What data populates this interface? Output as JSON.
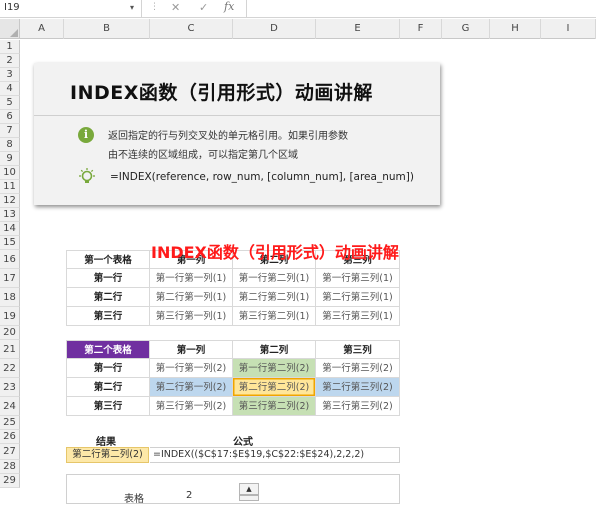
{
  "formula_bar": {
    "name_box": "I19",
    "cancel_icon": "✕",
    "confirm_icon": "✓",
    "fx_label": "fx"
  },
  "columns": [
    "A",
    "B",
    "C",
    "D",
    "E",
    "F",
    "G",
    "H",
    "I"
  ],
  "rows": [
    "1",
    "2",
    "3",
    "4",
    "5",
    "6",
    "7",
    "8",
    "9",
    "10",
    "11",
    "12",
    "13",
    "14",
    "15",
    "16",
    "17",
    "18",
    "19",
    "20",
    "21",
    "22",
    "23",
    "24",
    "25",
    "26",
    "27",
    "28",
    "29"
  ],
  "card": {
    "title": "INDEX函数（引用形式）动画讲解",
    "description_line1": "返回指定的行与列交叉处的单元格引用。如果引用参数",
    "description_line2": "由不连续的区域组成，可以指定第几个区域",
    "syntax": "=INDEX(reference, row_num, [column_num], [area_num])"
  },
  "overlay_title": "INDEX函数（引用形式）动画讲解",
  "table1": {
    "header": [
      "第一个表格",
      "第一列",
      "第二列",
      "第三列"
    ],
    "rows": [
      [
        "第一行",
        "第一行第一列(1)",
        "第一行第二列(1)",
        "第一行第三列(1)"
      ],
      [
        "第二行",
        "第二行第一列(1)",
        "第二行第二列(1)",
        "第二行第三列(1)"
      ],
      [
        "第三行",
        "第三行第一列(1)",
        "第三行第二列(1)",
        "第三行第三列(1)"
      ]
    ]
  },
  "table2": {
    "header": [
      "第二个表格",
      "第一列",
      "第二列",
      "第三列"
    ],
    "rows": [
      [
        "第一行",
        "第一行第一列(2)",
        "第一行第二列(2)",
        "第一行第三列(2)"
      ],
      [
        "第二行",
        "第二行第一列(2)",
        "第二行第二列(2)",
        "第二行第三列(2)"
      ],
      [
        "第三行",
        "第三行第一列(2)",
        "第三行第二列(2)",
        "第三行第三列(2)"
      ]
    ],
    "colors": {
      "header_bg": "#7030a0",
      "column_highlight": "#c6e0b4",
      "row_highlight": "#bdd7ee",
      "intersection": "#ffe699",
      "intersection_border": "#f0a500"
    }
  },
  "result": {
    "result_label": "结果",
    "formula_label": "公式",
    "result_value": "第二行第二列(2)",
    "formula_text": "=INDEX(($C$17:$E$19,$C$22:$E$24),2,2,2)"
  },
  "controls": {
    "area_label": "表格",
    "area_value": "2",
    "spin_up_icon": "▲"
  },
  "colors": {
    "info_icon": "#79a93c",
    "overlay_red": "#ff1a1a",
    "result_bg": "#fde8a8"
  }
}
